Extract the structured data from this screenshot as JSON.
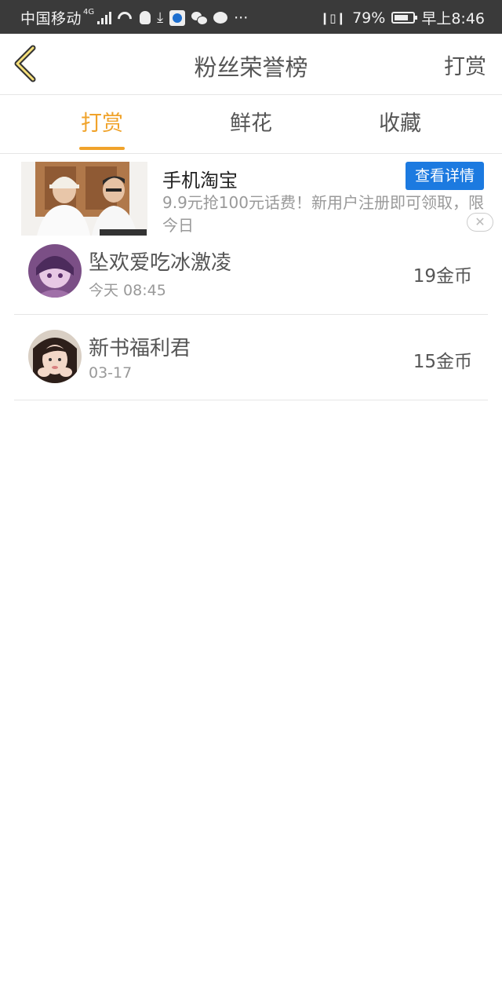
{
  "status_bar": {
    "carrier": "中国移动",
    "network": "4G",
    "more": "···",
    "battery_percent": "79%",
    "battery_level": 0.79,
    "time": "早上8:46"
  },
  "header": {
    "title": "粉丝荣誉榜",
    "right_action": "打赏"
  },
  "tabs": [
    {
      "label": "打赏",
      "active": true
    },
    {
      "label": "鲜花",
      "active": false
    },
    {
      "label": "收藏",
      "active": false
    }
  ],
  "ad": {
    "title": "手机淘宝",
    "button": "查看详情",
    "description": "9.9元抢100元话费！新用户注册即可领取，限今日",
    "close": "✕"
  },
  "rewards": [
    {
      "name": "坠欢爱吃冰激凌",
      "date": "今天 08:45",
      "amount": "19金币"
    },
    {
      "name": "新书福利君",
      "date": "03-17",
      "amount": "15金币"
    }
  ],
  "colors": {
    "accent": "#f0a32b",
    "ad_button": "#1c7ae0",
    "status_bar": "#3a3a3a"
  }
}
